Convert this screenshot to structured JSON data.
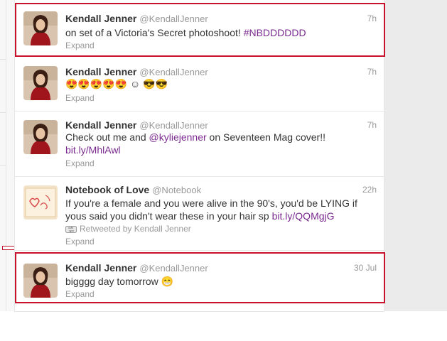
{
  "tweets": [
    {
      "fullname": "Kendall Jenner",
      "username": "@KendallJenner",
      "time": "7h",
      "text_pre": "on set of a Victoria's Secret photoshoot! ",
      "link": "#NBDDDDDD",
      "expand": "Expand"
    },
    {
      "fullname": "Kendall Jenner",
      "username": "@KendallJenner",
      "time": "7h",
      "text": "😍😍😍😍😍 ☺ 😎😎",
      "expand": "Expand"
    },
    {
      "fullname": "Kendall Jenner",
      "username": "@KendallJenner",
      "time": "7h",
      "text_pre": "Check out me and ",
      "mention": "@kyliejenner",
      "text_mid": " on Seventeen Mag cover!! ",
      "link": "bit.ly/MhlAwl",
      "expand": "Expand"
    },
    {
      "fullname": "Notebook of Love",
      "username": "@Notebook",
      "time": "22h",
      "text_pre": "If you're a female and you were alive in the 90's, you'd be LYING if yous said you didn't wear these in your hair sp ",
      "link": "bit.ly/QQMgjG",
      "retweeted_by": "Retweeted by Kendall Jenner",
      "expand": "Expand"
    },
    {
      "fullname": "Kendall Jenner",
      "username": "@KendallJenner",
      "time": "30 Jul",
      "text": "bigggg day tomorrow 😁",
      "expand": "Expand"
    }
  ],
  "colors": {
    "highlight": "#c9112e",
    "link": "#7a2a8f",
    "muted": "#999999"
  },
  "icons": [
    "avatar",
    "retweet-icon"
  ]
}
